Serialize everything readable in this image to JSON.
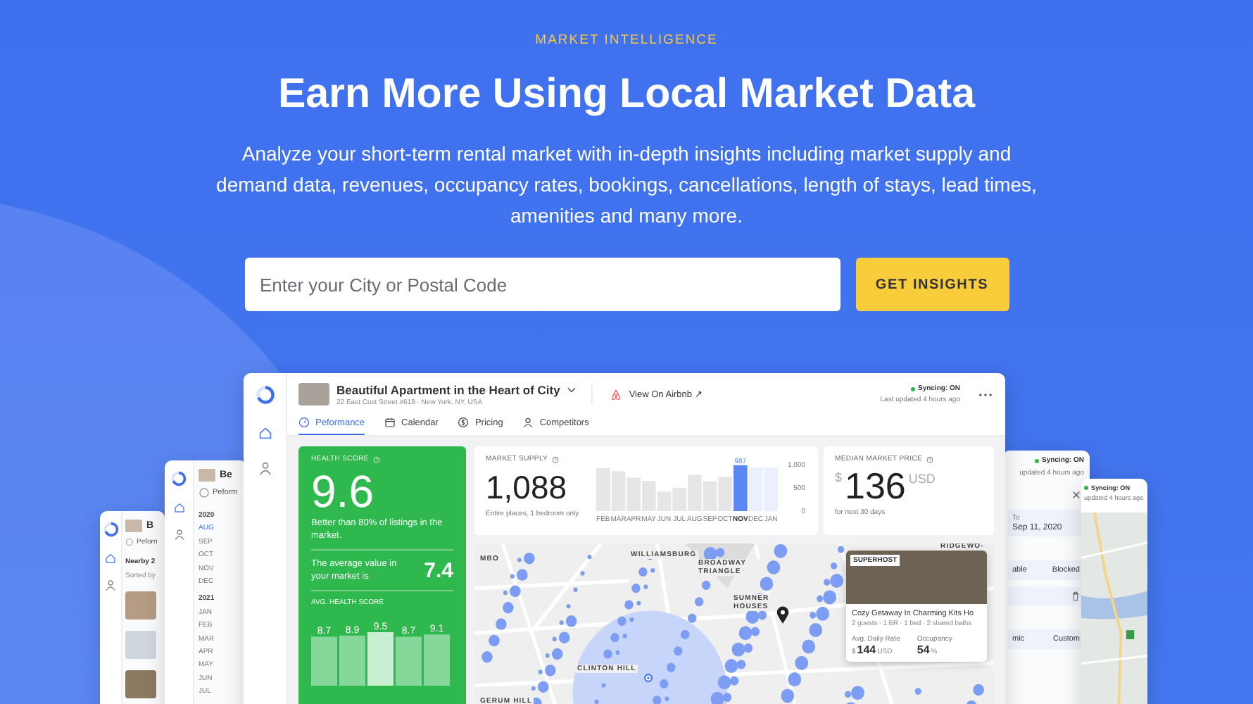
{
  "hero": {
    "eyebrow": "MARKET INTELLIGENCE",
    "title": "Earn More Using Local Market Data",
    "description": "Analyze your short-term rental market with in-depth insights including market supply and demand data, revenues, occupancy rates, bookings, cancellations, length of stays, lead times, amenities and many more."
  },
  "search": {
    "placeholder": "Enter your City or Postal Code",
    "button": "GET INSIGHTS"
  },
  "dashboard": {
    "listing_title": "Beautiful Apartment in the Heart of City",
    "address": "22 East Cost Street #618 · New York, NY, USA",
    "airbnb_link": "View On Airbnb ↗",
    "syncing": true,
    "sync_status": "Syncing: ON",
    "last_updated": "Last updated 4 hours ago",
    "tabs": [
      {
        "label": "Peformance",
        "selected": true
      },
      {
        "label": "Calendar",
        "selected": false
      },
      {
        "label": "Pricing",
        "selected": false
      },
      {
        "label": "Competitors",
        "selected": false
      }
    ],
    "health": {
      "label": "HEALTH SCORE",
      "score": "9.6",
      "note": "Better than 80% of listings in the market.",
      "avg_text": "The average value in your market is",
      "avg_value": "7.4",
      "chart_label": "AVG. HEALTH SCORE",
      "bar_labels": [
        "8.7",
        "8.9",
        "9.5",
        "8.7",
        "9.1"
      ]
    },
    "supply": {
      "label": "MARKET SUPPLY",
      "value": "1,088",
      "note": "Entire places, 1 bedroom only",
      "chart_data": {
        "type": "bar",
        "categories": [
          "FEB",
          "MAR",
          "APR",
          "MAY",
          "JUN",
          "JUL",
          "AUG",
          "SEP",
          "OCT",
          "NOV",
          "DEC",
          "JAN"
        ],
        "values": [
          930,
          860,
          720,
          650,
          420,
          500,
          780,
          640,
          740,
          987,
          940,
          940
        ],
        "ylim": [
          0,
          1000
        ],
        "yticks": [
          {
            "value": 0,
            "label": "0"
          },
          {
            "value": 500,
            "label": "500"
          },
          {
            "value": 1000,
            "label": "1,000"
          }
        ],
        "annotations": [
          {
            "x": "NOV",
            "y": 987,
            "text": "987"
          }
        ]
      }
    },
    "price": {
      "label": "MEDIAN MARKET PRICE",
      "currency": "$",
      "value": "136",
      "unit": "USD",
      "note": "for next 30 days"
    },
    "map_labels": [
      "MBO",
      "WILLIAMSBURG",
      "BROADWAY TRIANGLE",
      "RIDGEWO-",
      "SUMNER HOUSES",
      "CLINTON HILL",
      "GERUM HILL"
    ],
    "listing_card": {
      "badge": "SUPERHOST",
      "title": "Cozy Getaway In Charming Kits Ho",
      "details": "2 guests · 1 BR · 1 bed · 2 shared baths",
      "rate_label": "Avg. Daily Rate",
      "rate_currency": "$",
      "rate": "144",
      "rate_unit": "USD",
      "occupancy_label": "Occupancy",
      "occupancy": "54",
      "occupancy_unit": "%"
    }
  },
  "nearby_window": {
    "title": "B",
    "tab": "Peforn",
    "heading": "Nearby 2",
    "sort": "Sorted by"
  },
  "calendar_window": {
    "title": "Be",
    "tab": "Peform",
    "years": [
      {
        "year": "2020",
        "months": [
          {
            "label": "AUG",
            "selected": true
          },
          {
            "label": "SEP",
            "selected": false
          },
          {
            "label": "OCT",
            "selected": false
          },
          {
            "label": "NOV",
            "selected": false
          },
          {
            "label": "DEC",
            "selected": false
          }
        ]
      },
      {
        "year": "2021",
        "months": [
          {
            "label": "JAN",
            "selected": false
          },
          {
            "label": "FEB",
            "selected": false
          },
          {
            "label": "MAR",
            "selected": false
          },
          {
            "label": "APR",
            "selected": false
          },
          {
            "label": "MAY",
            "selected": false
          },
          {
            "label": "JUN",
            "selected": false
          },
          {
            "label": "JUL",
            "selected": false
          }
        ]
      }
    ]
  },
  "booking_window": {
    "sync_status": "Syncing: ON",
    "last_updated": "updated 4 hours ago",
    "to_label": "To",
    "date": "Sep 11, 2020",
    "statuses": [
      "able",
      "Blocked"
    ],
    "modes": [
      "mic",
      "Custom"
    ]
  },
  "map_window": {
    "sync_status": "Syncing: ON",
    "last_updated": "updated 4 hours ago"
  }
}
